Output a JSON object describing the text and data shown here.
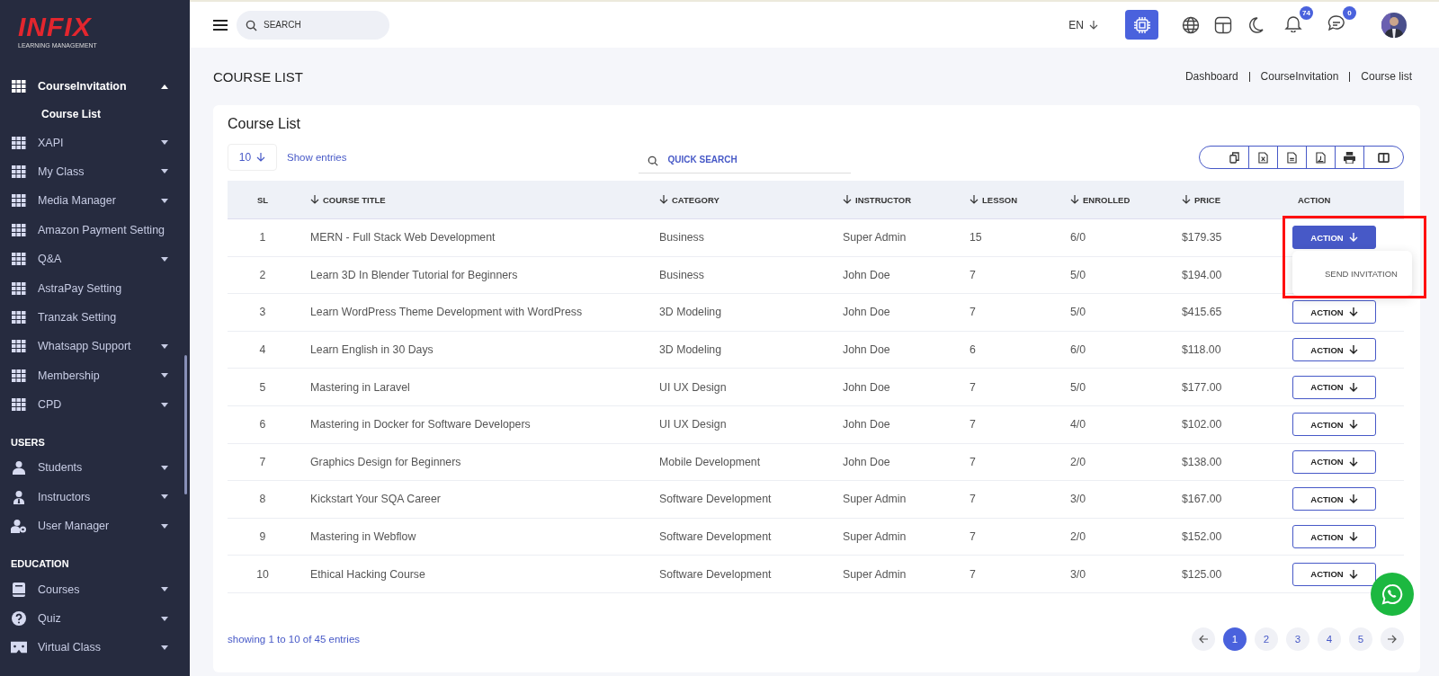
{
  "logo": {
    "name": "INFIX",
    "tagline": "LEARNING MANAGEMENT"
  },
  "sidebar": {
    "groups": [
      {
        "items": [
          {
            "label": "CourseInvitation",
            "kind": "grid",
            "has_submenu": true,
            "expanded": true,
            "children": [
              {
                "label": "Course List",
                "selected": true
              }
            ]
          },
          {
            "label": "XAPI",
            "kind": "grid",
            "has_submenu": true,
            "expanded": false
          },
          {
            "label": "My Class",
            "kind": "grid",
            "has_submenu": true,
            "expanded": false
          },
          {
            "label": "Media Manager",
            "kind": "grid",
            "has_submenu": true,
            "expanded": false
          },
          {
            "label": "Amazon Payment Setting",
            "kind": "grid",
            "has_submenu": false,
            "expanded": false
          },
          {
            "label": "Q&A",
            "kind": "grid",
            "has_submenu": true,
            "expanded": false
          },
          {
            "label": "AstraPay Setting",
            "kind": "grid",
            "has_submenu": false,
            "expanded": false
          },
          {
            "label": "Tranzak Setting",
            "kind": "grid",
            "has_submenu": false,
            "expanded": false
          },
          {
            "label": "Whatsapp Support",
            "kind": "grid",
            "has_submenu": true,
            "expanded": false
          },
          {
            "label": "Membership",
            "kind": "grid",
            "has_submenu": true,
            "expanded": false
          },
          {
            "label": "CPD",
            "kind": "grid",
            "has_submenu": true,
            "expanded": false
          }
        ]
      },
      {
        "heading": "USERS",
        "items": [
          {
            "label": "Students",
            "kind": "user",
            "has_submenu": true,
            "expanded": false
          },
          {
            "label": "Instructors",
            "kind": "instructor",
            "has_submenu": true,
            "expanded": false
          },
          {
            "label": "User Manager",
            "kind": "usergear",
            "has_submenu": true,
            "expanded": false
          }
        ]
      },
      {
        "heading": "EDUCATION",
        "items": [
          {
            "label": "Courses",
            "kind": "book",
            "has_submenu": true,
            "expanded": false
          },
          {
            "label": "Quiz",
            "kind": "question",
            "has_submenu": true,
            "expanded": false
          },
          {
            "label": "Virtual Class",
            "kind": "vr",
            "has_submenu": true,
            "expanded": false
          }
        ]
      }
    ]
  },
  "header": {
    "search": {
      "placeholder": "SEARCH"
    },
    "language": "EN",
    "ai_active": true,
    "notifications": "74",
    "messages": "0"
  },
  "page": {
    "title": "COURSE LIST",
    "breadcrumb": [
      "Dashboard",
      "CourseInvitation",
      "Course list"
    ]
  },
  "card": {
    "title": "Course List",
    "page_size": "10",
    "show_entries": "Show entries",
    "quick_search": {
      "placeholder": "QUICK SEARCH"
    }
  },
  "table": {
    "columns": [
      {
        "label": "SL",
        "sortable": false
      },
      {
        "label": "COURSE TITLE",
        "sortable": true
      },
      {
        "label": "CATEGORY",
        "sortable": true
      },
      {
        "label": "INSTRUCTOR",
        "sortable": true
      },
      {
        "label": "LESSON",
        "sortable": true
      },
      {
        "label": "ENROLLED",
        "sortable": true
      },
      {
        "label": "PRICE",
        "sortable": true
      },
      {
        "label": "ACTION",
        "sortable": false
      }
    ],
    "action_menu": [
      "SEND INVITATION"
    ],
    "rows": [
      {
        "cells": [
          "1",
          "MERN - Full Stack Web Development",
          "Business",
          "Super Admin",
          "15",
          "6/0",
          "$179.35"
        ],
        "action": "ACTION",
        "menu_open": true
      },
      {
        "cells": [
          "2",
          "Learn 3D In Blender Tutorial for Beginners",
          "Business",
          "John Doe",
          "7",
          "5/0",
          "$194.00"
        ]
      },
      {
        "cells": [
          "3",
          "Learn WordPress Theme Development with WordPress",
          "3D Modeling",
          "John Doe",
          "7",
          "5/0",
          "$415.65"
        ],
        "action": "ACTION",
        "menu_open": false
      },
      {
        "cells": [
          "4",
          "Learn English in 30 Days",
          "3D Modeling",
          "John Doe",
          "6",
          "6/0",
          "$118.00"
        ],
        "action": "ACTION",
        "menu_open": false
      },
      {
        "cells": [
          "5",
          "Mastering in Laravel",
          "UI UX Design",
          "John Doe",
          "7",
          "5/0",
          "$177.00"
        ],
        "action": "ACTION",
        "menu_open": false
      },
      {
        "cells": [
          "6",
          "Mastering in Docker for Software Developers",
          "UI UX Design",
          "John Doe",
          "7",
          "4/0",
          "$102.00"
        ],
        "action": "ACTION",
        "menu_open": false
      },
      {
        "cells": [
          "7",
          "Graphics Design for Beginners",
          "Mobile Development",
          "John Doe",
          "7",
          "2/0",
          "$138.00"
        ],
        "action": "ACTION",
        "menu_open": false
      },
      {
        "cells": [
          "8",
          "Kickstart Your SQA Career",
          "Software Development",
          "Super Admin",
          "7",
          "3/0",
          "$167.00"
        ],
        "action": "ACTION",
        "menu_open": false
      },
      {
        "cells": [
          "9",
          "Mastering in Webflow",
          "Software Development",
          "Super Admin",
          "7",
          "2/0",
          "$152.00"
        ],
        "action": "ACTION",
        "menu_open": false
      },
      {
        "cells": [
          "10",
          "Ethical Hacking Course",
          "Software Development",
          "Super Admin",
          "7",
          "3/0",
          "$125.00"
        ],
        "action": "ACTION",
        "menu_open": false
      }
    ]
  },
  "footer": {
    "summary": "showing 1 to 10 of 45 entries",
    "pages": [
      {
        "label": "1",
        "selected": true
      },
      {
        "label": "2",
        "selected": false
      },
      {
        "label": "3",
        "selected": false
      },
      {
        "label": "4",
        "selected": false
      },
      {
        "label": "5",
        "selected": false
      }
    ]
  }
}
